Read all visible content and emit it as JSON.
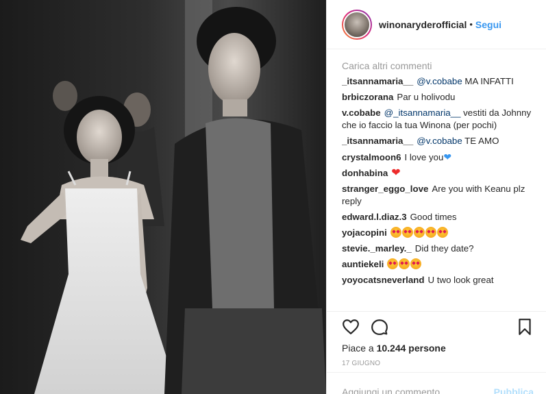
{
  "post": {
    "username": "winonaryderofficial",
    "separator": "•",
    "follow_label": "Segui"
  },
  "comments": {
    "load_more": "Carica altri commenti",
    "items": [
      {
        "user": "_itsannamaria__",
        "mention": "@v.cobabe",
        "text": " MA INFATTI"
      },
      {
        "user": "brbiczorana",
        "mention": "",
        "text": "Par u holivodu"
      },
      {
        "user": "v.cobabe",
        "mention": "@_itsannamaria__",
        "text": " vestiti da Johnny che io faccio la tua Winona (per pochi)"
      },
      {
        "user": "_itsannamaria__",
        "mention": "@v.cobabe",
        "text": " TE AMO"
      },
      {
        "user": "crystalmoon6",
        "mention": "",
        "text": "I love you",
        "emoji": "blue-heart"
      },
      {
        "user": "donhabina",
        "mention": "",
        "text": "",
        "emoji": "red-heart"
      },
      {
        "user": "stranger_eggo_love",
        "mention": "",
        "text": "Are you with Keanu plz reply"
      },
      {
        "user": "edward.l.diaz.3",
        "mention": "",
        "text": "Good times"
      },
      {
        "user": "yojacopini",
        "mention": "",
        "text": "",
        "emoji_count": 5
      },
      {
        "user": "stevie._marley._",
        "mention": "",
        "text": "Did they date?"
      },
      {
        "user": "auntiekeli",
        "mention": "",
        "text": "",
        "emoji_count": 3
      },
      {
        "user": "yoyocatsneverland",
        "mention": "",
        "text": "U two look great"
      }
    ]
  },
  "icons": {
    "like": "heart-outline-icon",
    "comment": "speech-bubble-icon",
    "save": "bookmark-icon",
    "star_eyes": "star-struck-emoji-icon"
  },
  "likes": {
    "prefix": "Piace a ",
    "count": "10.244",
    "suffix": " persone"
  },
  "date": "17 GIUGNO",
  "add_comment": {
    "placeholder": "Aggiungi un commento...",
    "publish_label": "Pubblica"
  },
  "colors": {
    "link_blue": "#3897f0",
    "mention_blue": "#003569",
    "muted_gray": "#999999",
    "heart_red": "#ed2b2b"
  }
}
